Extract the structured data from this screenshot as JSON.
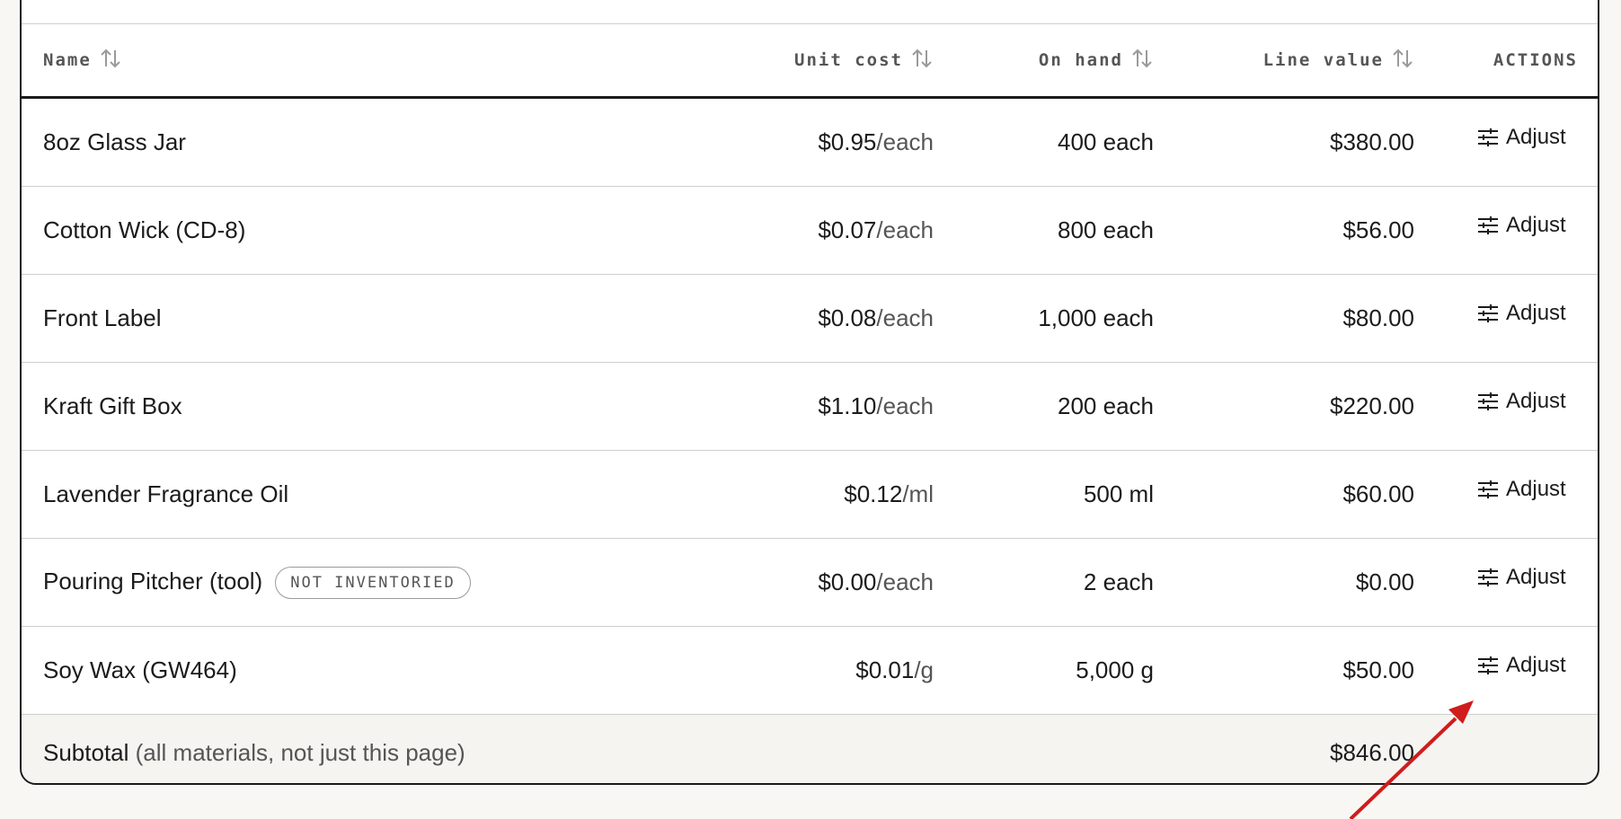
{
  "table": {
    "headers": {
      "name": "Name",
      "unit_cost": "Unit cost",
      "on_hand": "On hand",
      "line_value": "Line value",
      "actions": "ACTIONS"
    },
    "rows": [
      {
        "name": "8oz Glass Jar",
        "cost": "$0.95",
        "cost_unit": "/each",
        "on_hand": "400 each",
        "value": "$380.00",
        "action": "Adjust"
      },
      {
        "name": "Cotton Wick (CD-8)",
        "cost": "$0.07",
        "cost_unit": "/each",
        "on_hand": "800 each",
        "value": "$56.00",
        "action": "Adjust"
      },
      {
        "name": "Front Label",
        "cost": "$0.08",
        "cost_unit": "/each",
        "on_hand": "1,000 each",
        "value": "$80.00",
        "action": "Adjust"
      },
      {
        "name": "Kraft Gift Box",
        "cost": "$1.10",
        "cost_unit": "/each",
        "on_hand": "200 each",
        "value": "$220.00",
        "action": "Adjust"
      },
      {
        "name": "Lavender Fragrance Oil",
        "cost": "$0.12",
        "cost_unit": "/ml",
        "on_hand": "500 ml",
        "value": "$60.00",
        "action": "Adjust"
      },
      {
        "name": "Pouring Pitcher (tool)",
        "badge": "NOT INVENTORIED",
        "cost": "$0.00",
        "cost_unit": "/each",
        "on_hand": "2 each",
        "value": "$0.00",
        "action": "Adjust"
      },
      {
        "name": "Soy Wax (GW464)",
        "cost": "$0.01",
        "cost_unit": "/g",
        "on_hand": "5,000 g",
        "value": "$50.00",
        "action": "Adjust"
      }
    ],
    "subtotal": {
      "label": "Subtotal",
      "note": "(all materials, not just this page)",
      "value": "$846.00"
    }
  },
  "colors": {
    "border": "#1b1b1b",
    "muted": "#555555",
    "subtotal_bg": "#f5f4f1",
    "annotation_arrow": "#d01c1c"
  },
  "icons": {
    "sort": "sort-arrows-icon",
    "adjust": "sliders-icon"
  }
}
